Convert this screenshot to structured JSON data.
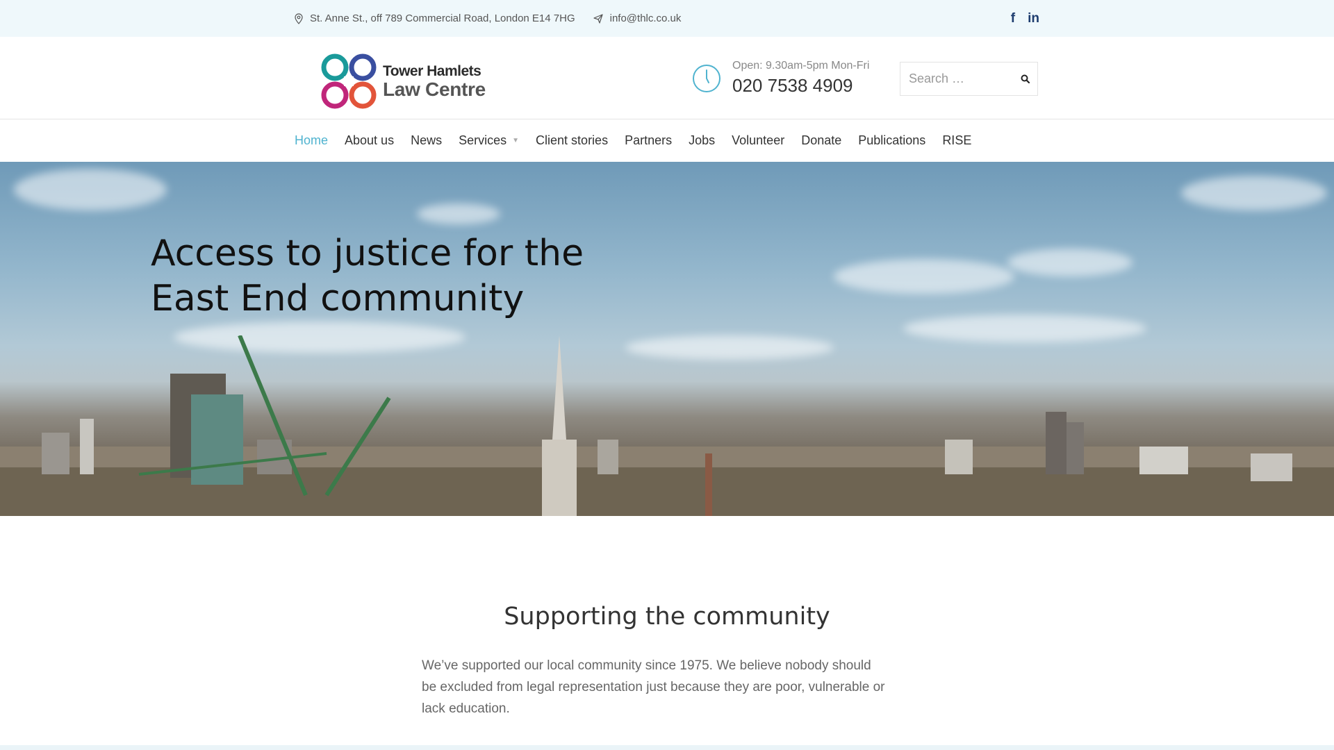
{
  "topbar": {
    "address": "St. Anne St., off 789 Commercial Road, London E14 7HG",
    "email": "info@thlc.co.uk",
    "social": {
      "facebook": "f",
      "linkedin": "in"
    }
  },
  "header": {
    "logo": {
      "line1": "Tower Hamlets",
      "line2": "Law Centre"
    },
    "hours": "Open: 9.30am-5pm Mon-Fri",
    "phone": "020 7538 4909",
    "search_placeholder": "Search …"
  },
  "nav": {
    "items": [
      {
        "label": "Home"
      },
      {
        "label": "About us"
      },
      {
        "label": "News"
      },
      {
        "label": "Services"
      },
      {
        "label": "Client stories"
      },
      {
        "label": "Partners"
      },
      {
        "label": "Jobs"
      },
      {
        "label": "Volunteer"
      },
      {
        "label": "Donate"
      },
      {
        "label": "Publications"
      },
      {
        "label": "RISE"
      }
    ],
    "active": "Home"
  },
  "hero": {
    "heading_line1": "Access to justice for the",
    "heading_line2": "East End community"
  },
  "content": {
    "heading": "Supporting the community",
    "paragraph": "We’ve supported our local community since 1975. We believe nobody should be excluded from legal representation just because they are poor, vulnerable or lack education."
  },
  "colors": {
    "accent": "#4fb3cf",
    "topbar_bg": "#eff8fb",
    "social": "#1d3c6e",
    "logo_teal": "#1a9a9a",
    "logo_blue": "#3a4fa0",
    "logo_magenta": "#c0267a",
    "logo_orange": "#e2543a"
  },
  "icons": {
    "address": "map-pin-icon",
    "email": "paper-plane-icon",
    "clock": "clock-icon",
    "search": "search-icon"
  }
}
